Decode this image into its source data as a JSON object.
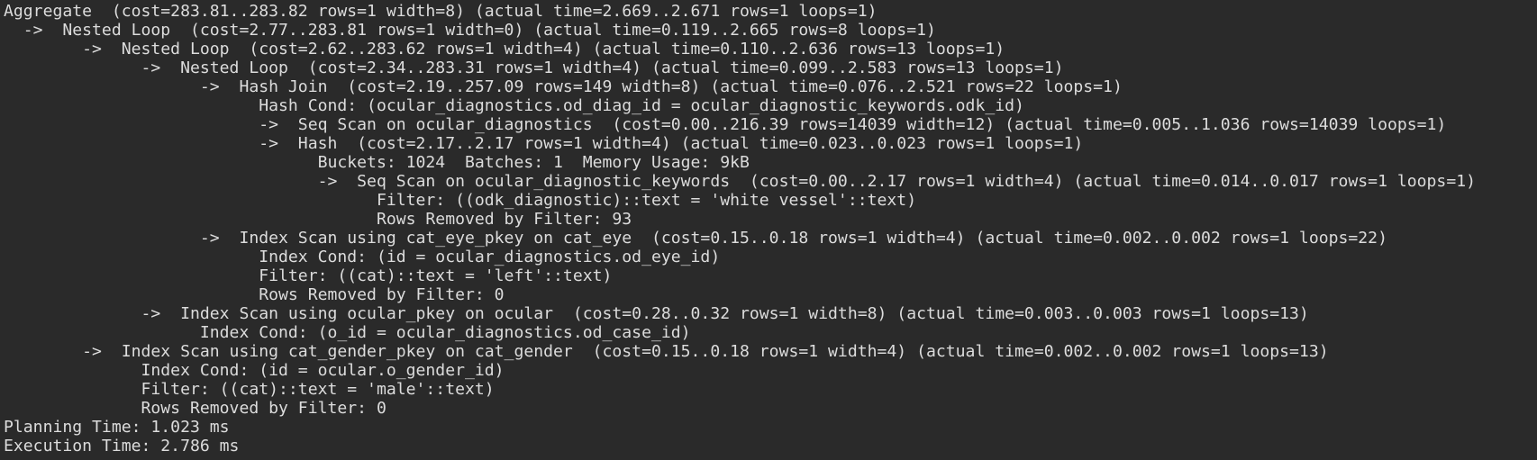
{
  "terminal": {
    "lines": [
      "Aggregate  (cost=283.81..283.82 rows=1 width=8) (actual time=2.669..2.671 rows=1 loops=1)",
      "  ->  Nested Loop  (cost=2.77..283.81 rows=1 width=0) (actual time=0.119..2.665 rows=8 loops=1)",
      "        ->  Nested Loop  (cost=2.62..283.62 rows=1 width=4) (actual time=0.110..2.636 rows=13 loops=1)",
      "              ->  Nested Loop  (cost=2.34..283.31 rows=1 width=4) (actual time=0.099..2.583 rows=13 loops=1)",
      "                    ->  Hash Join  (cost=2.19..257.09 rows=149 width=8) (actual time=0.076..2.521 rows=22 loops=1)",
      "                          Hash Cond: (ocular_diagnostics.od_diag_id = ocular_diagnostic_keywords.odk_id)",
      "                          ->  Seq Scan on ocular_diagnostics  (cost=0.00..216.39 rows=14039 width=12) (actual time=0.005..1.036 rows=14039 loops=1)",
      "                          ->  Hash  (cost=2.17..2.17 rows=1 width=4) (actual time=0.023..0.023 rows=1 loops=1)",
      "                                Buckets: 1024  Batches: 1  Memory Usage: 9kB",
      "                                ->  Seq Scan on ocular_diagnostic_keywords  (cost=0.00..2.17 rows=1 width=4) (actual time=0.014..0.017 rows=1 loops=1)",
      "                                      Filter: ((odk_diagnostic)::text = 'white vessel'::text)",
      "                                      Rows Removed by Filter: 93",
      "                    ->  Index Scan using cat_eye_pkey on cat_eye  (cost=0.15..0.18 rows=1 width=4) (actual time=0.002..0.002 rows=1 loops=22)",
      "                          Index Cond: (id = ocular_diagnostics.od_eye_id)",
      "                          Filter: ((cat)::text = 'left'::text)",
      "                          Rows Removed by Filter: 0",
      "              ->  Index Scan using ocular_pkey on ocular  (cost=0.28..0.32 rows=1 width=8) (actual time=0.003..0.003 rows=1 loops=13)",
      "                    Index Cond: (o_id = ocular_diagnostics.od_case_id)",
      "        ->  Index Scan using cat_gender_pkey on cat_gender  (cost=0.15..0.18 rows=1 width=4) (actual time=0.002..0.002 rows=1 loops=13)",
      "              Index Cond: (id = ocular.o_gender_id)",
      "              Filter: ((cat)::text = 'male'::text)",
      "              Rows Removed by Filter: 0",
      "Planning Time: 1.023 ms",
      "Execution Time: 2.786 ms"
    ]
  }
}
